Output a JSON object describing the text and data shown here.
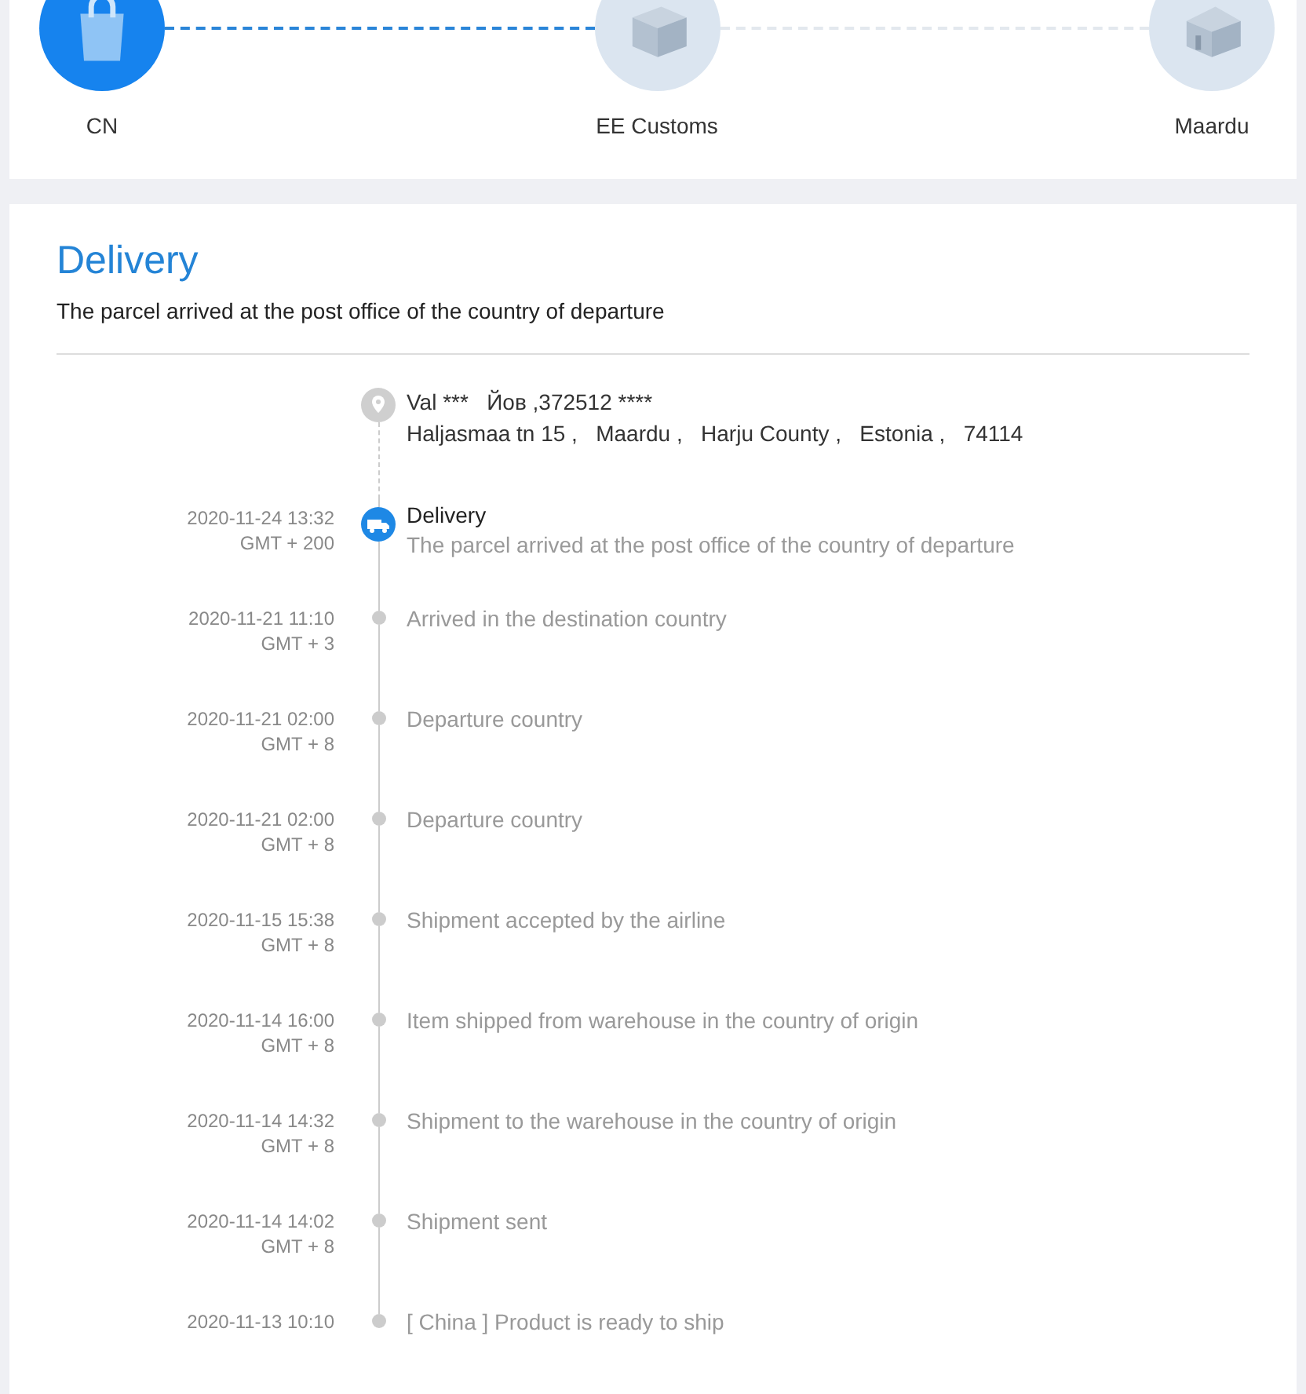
{
  "route": {
    "steps": [
      {
        "label": "CN",
        "reached": true,
        "kind": "bag"
      },
      {
        "label": "EE Customs",
        "reached": false,
        "kind": "box"
      },
      {
        "label": "Maardu",
        "reached": false,
        "kind": "house"
      }
    ]
  },
  "delivery": {
    "title": "Delivery",
    "subtitle": "The parcel arrived at the post office of the country of departure",
    "address": {
      "name": "Val ***   Йов ,372512 ****",
      "line": "Haljasmaa tn 15 ,   Maardu ,   Harju County ,   Estonia ,   74114"
    },
    "events": [
      {
        "time": "2020-11-24 13:32",
        "zone": "GMT + 200",
        "title": "Delivery",
        "text": "The parcel arrived at the post office of the country of departure",
        "current": true
      },
      {
        "time": "2020-11-21 11:10",
        "zone": "GMT + 3",
        "text": "Arrived in the destination country",
        "current": false
      },
      {
        "time": "2020-11-21 02:00",
        "zone": "GMT + 8",
        "text": "Departure country",
        "current": false
      },
      {
        "time": "2020-11-21 02:00",
        "zone": "GMT + 8",
        "text": "Departure country",
        "current": false
      },
      {
        "time": "2020-11-15 15:38",
        "zone": "GMT + 8",
        "text": "Shipment accepted by the airline",
        "current": false
      },
      {
        "time": "2020-11-14 16:00",
        "zone": "GMT + 8",
        "text": "Item shipped from warehouse in the country of origin",
        "current": false
      },
      {
        "time": "2020-11-14 14:32",
        "zone": "GMT + 8",
        "text": "Shipment to the warehouse in the country of origin",
        "current": false
      },
      {
        "time": "2020-11-14 14:02",
        "zone": "GMT + 8",
        "text": "Shipment sent",
        "current": false
      },
      {
        "time": "2020-11-13 10:10",
        "text": "[ China ] Product is ready to ship",
        "current": false
      }
    ]
  }
}
